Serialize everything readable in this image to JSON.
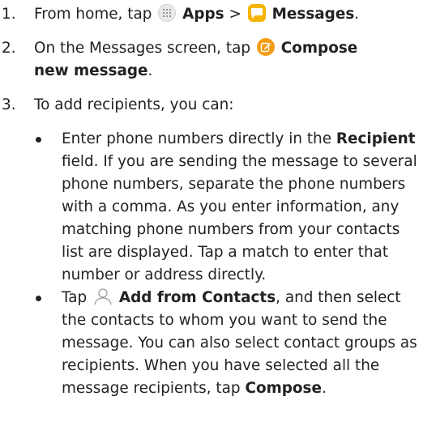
{
  "steps": [
    {
      "number": "1.",
      "pre": "From home, tap",
      "apps_label": "Apps",
      "sep": " > ",
      "messages_label": "Messages",
      "end": "."
    },
    {
      "number": "2.",
      "pre": "On the Messages screen, tap",
      "compose_label": "Compose new message",
      "end": "."
    },
    {
      "number": "3.",
      "text": "To add recipients, you can:"
    }
  ],
  "bullets": [
    {
      "pre": "Enter phone numbers directly in the",
      "bold": "Recipient",
      "post": "field. If you are sending the message to several phone numbers, separate the phone numbers with a comma. As you enter information, any matching phone numbers from your contacts list are displayed. Tap a match to enter that number or address directly."
    },
    {
      "pre": "Tap",
      "bold": "Add from Contacts",
      "post": ", and then select the contacts to whom you want to send the message. You can also select contact groups as recipients. When you have selected all the message recipients, tap",
      "bold2": "Compose",
      "end": "."
    }
  ],
  "colors": {
    "text": "#222222",
    "messages_icon": "#f4b400",
    "compose_icon": "#f39c12",
    "apps_icon_bg": "#e9e9e9"
  },
  "icons": [
    "apps-icon",
    "messages-icon",
    "compose-icon",
    "contact-icon"
  ]
}
